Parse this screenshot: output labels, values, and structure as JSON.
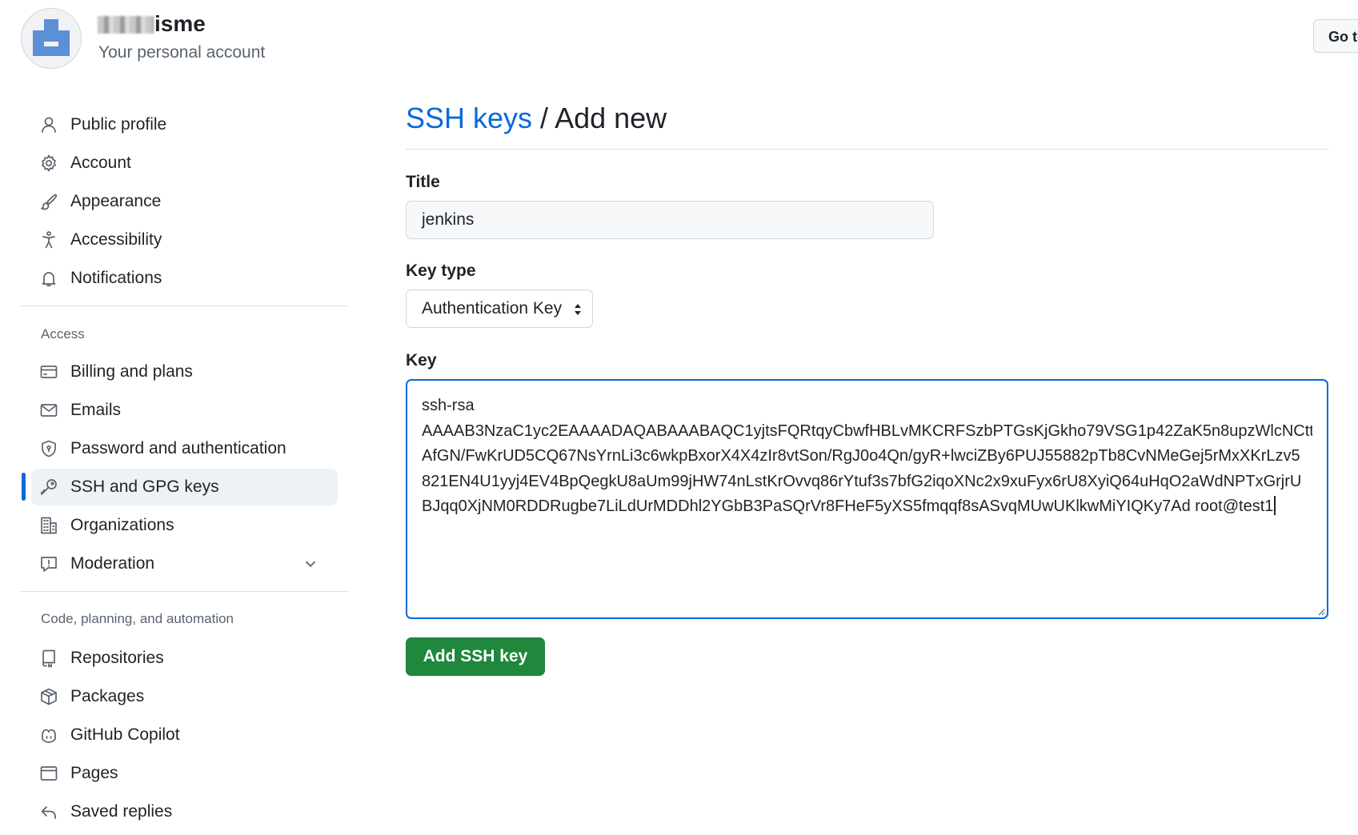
{
  "header": {
    "username_visible": "isme",
    "subtitle": "Your personal account",
    "goto_button": "Go to"
  },
  "sidebar": {
    "top_items": [
      {
        "label": "Public profile",
        "icon": "person-icon"
      },
      {
        "label": "Account",
        "icon": "gear-icon"
      },
      {
        "label": "Appearance",
        "icon": "paintbrush-icon"
      },
      {
        "label": "Accessibility",
        "icon": "accessibility-icon"
      },
      {
        "label": "Notifications",
        "icon": "bell-icon"
      }
    ],
    "access_heading": "Access",
    "access_items": [
      {
        "label": "Billing and plans",
        "icon": "credit-card-icon"
      },
      {
        "label": "Emails",
        "icon": "mail-icon"
      },
      {
        "label": "Password and authentication",
        "icon": "shield-icon"
      },
      {
        "label": "SSH and GPG keys",
        "icon": "key-icon",
        "active": true
      },
      {
        "label": "Organizations",
        "icon": "organization-icon"
      },
      {
        "label": "Moderation",
        "icon": "report-icon"
      }
    ],
    "code_heading": "Code, planning, and automation",
    "code_items": [
      {
        "label": "Repositories",
        "icon": "repo-icon"
      },
      {
        "label": "Packages",
        "icon": "package-icon"
      },
      {
        "label": "GitHub Copilot",
        "icon": "copilot-icon"
      },
      {
        "label": "Pages",
        "icon": "browser-icon"
      },
      {
        "label": "Saved replies",
        "icon": "reply-icon"
      }
    ]
  },
  "main": {
    "breadcrumb_link": "SSH keys",
    "title_suffix": " / Add new",
    "title_label": "Title",
    "title_value": "jenkins",
    "key_type_label": "Key type",
    "key_type_value": "Authentication Key",
    "key_label": "Key",
    "key_lines": [
      "ssh-rsa",
      "AAAAB3NzaC1yc2EAAAADAQABAAABAQC1yjtsFQRtqyCbwfHBLvMKCRFSzbPTGsKjGkho79VSG1p42ZaK5n8upzWlcNCtt",
      "AfGN/FwKrUD5CQ67NsYrnLi3c6wkpBxorX4X4zIr8vtSon/RgJ0o4Qn/gyR+lwciZBy6PUJ55882pTb8CvNMeGej5rMxXKrLzv5",
      "821EN4U1yyj4EV4BpQegkU8aUm99jHW74nLstKrOvvq86rYtuf3s7bfG2iqoXNc2x9xuFyx6rU8XyiQ64uHqO2aWdNPTxGrjrU",
      "BJqq0XjNM0RDDRugbe7LiLdUrMDDhl2YGbB3PaSQrVr8FHeF5yXS5fmqqf8sASvqMUwUKlkwMiYIQKy7Ad root@test1"
    ],
    "submit_label": "Add SSH key"
  }
}
